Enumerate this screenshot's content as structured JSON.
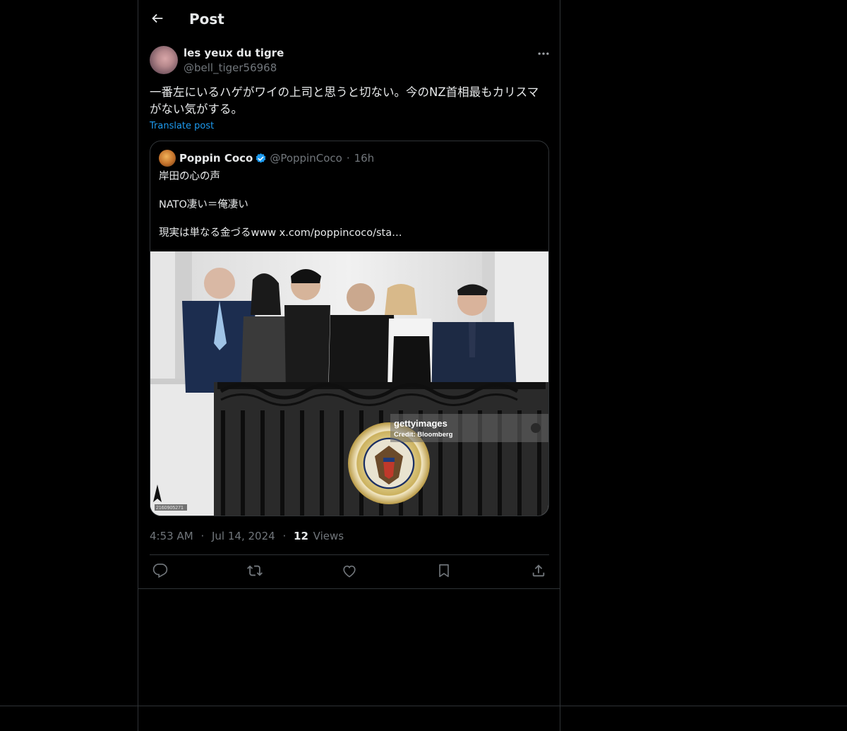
{
  "header": {
    "title": "Post"
  },
  "author": {
    "display_name": "les yeux du tigre",
    "handle": "@bell_tiger56968"
  },
  "post": {
    "text": "一番左にいるハゲがワイの上司と思うと切ない。今のNZ首相最もカリスマがない気がする。",
    "translate_label": "Translate post"
  },
  "quote": {
    "display_name": "Poppin Coco",
    "handle": "@PoppinCoco",
    "separator": "·",
    "time": "16h",
    "lines": [
      "岸田の心の声",
      "NATO凄い＝俺凄い",
      "現実は単なる金づるwww  x.com/poppincoco/sta…"
    ],
    "image": {
      "watermark_brand": "gettyimages",
      "watermark_credit": "Credit: Bloomberg",
      "image_id": "2160905271"
    }
  },
  "meta": {
    "time": "4:53 AM",
    "separator": "·",
    "date": "Jul 14, 2024",
    "views_count": "12",
    "views_label": "Views"
  },
  "icons": {
    "back": "arrow-left-icon",
    "more": "more-horizontal-icon",
    "verified": "verified-badge-icon",
    "reply": "reply-icon",
    "repost": "repost-icon",
    "like": "heart-icon",
    "bookmark": "bookmark-icon",
    "share": "share-icon"
  },
  "colors": {
    "background": "#000000",
    "text": "#e7e9ea",
    "muted": "#71767b",
    "accent": "#1d9bf0",
    "border": "#2f3336"
  }
}
